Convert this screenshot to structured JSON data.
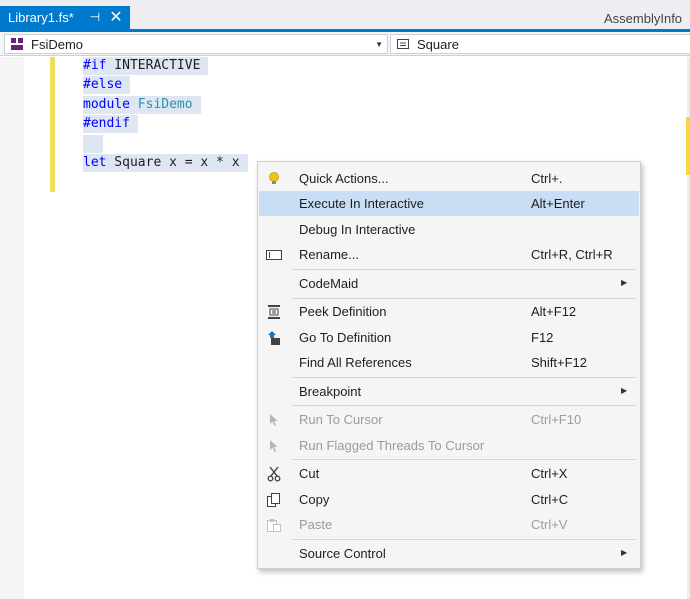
{
  "tabs": {
    "active": {
      "title": "Library1.fs*",
      "pin_glyph": "⊣",
      "close_glyph": "✕"
    },
    "other": {
      "title": "AssemblyInfo"
    }
  },
  "navbar": {
    "left_value": "FsiDemo",
    "right_value": "Square"
  },
  "code": {
    "line1": {
      "kw": "#if",
      "rest": " INTERACTIVE"
    },
    "line2": {
      "kw": "#else"
    },
    "line3": {
      "kw": "module",
      "type": "FsiDemo"
    },
    "line4": {
      "kw": "#endif"
    },
    "line6": {
      "kw": "let",
      "rest": " Square x = x * x"
    }
  },
  "context_menu": {
    "items": [
      {
        "label": "Quick Actions...",
        "shortcut": "Ctrl+.",
        "icon": "lightbulb-icon"
      },
      {
        "label": "Execute In Interactive",
        "shortcut": "Alt+Enter",
        "highlighted": true
      },
      {
        "label": "Debug In Interactive",
        "shortcut": ""
      },
      {
        "label": "Rename...",
        "shortcut": "Ctrl+R, Ctrl+R",
        "icon": "rename-icon"
      },
      {
        "label": "CodeMaid",
        "shortcut": "",
        "submenu": true
      },
      {
        "label": "Peek Definition",
        "shortcut": "Alt+F12",
        "icon": "peek-definition-icon"
      },
      {
        "label": "Go To Definition",
        "shortcut": "F12",
        "icon": "go-to-definition-icon"
      },
      {
        "label": "Find All References",
        "shortcut": "Shift+F12"
      },
      {
        "label": "Breakpoint",
        "shortcut": "",
        "submenu": true
      },
      {
        "label": "Run To Cursor",
        "shortcut": "Ctrl+F10",
        "disabled": true,
        "icon": "cursor-arrow-icon"
      },
      {
        "label": "Run Flagged Threads To Cursor",
        "shortcut": "",
        "disabled": true,
        "icon": "cursor-arrow-icon"
      },
      {
        "label": "Cut",
        "shortcut": "Ctrl+X",
        "icon": "scissors-icon"
      },
      {
        "label": "Copy",
        "shortcut": "Ctrl+C",
        "icon": "copy-icon"
      },
      {
        "label": "Paste",
        "shortcut": "Ctrl+V",
        "disabled": true,
        "icon": "paste-icon"
      },
      {
        "label": "Source Control",
        "shortcut": "",
        "submenu": true
      }
    ]
  },
  "colors": {
    "accent": "#007acc",
    "highlight": "#c9def5",
    "selection": "#dde6f2",
    "keyword": "#0000ff",
    "type": "#2b91af",
    "disabled_text": "#9b9b9b"
  }
}
